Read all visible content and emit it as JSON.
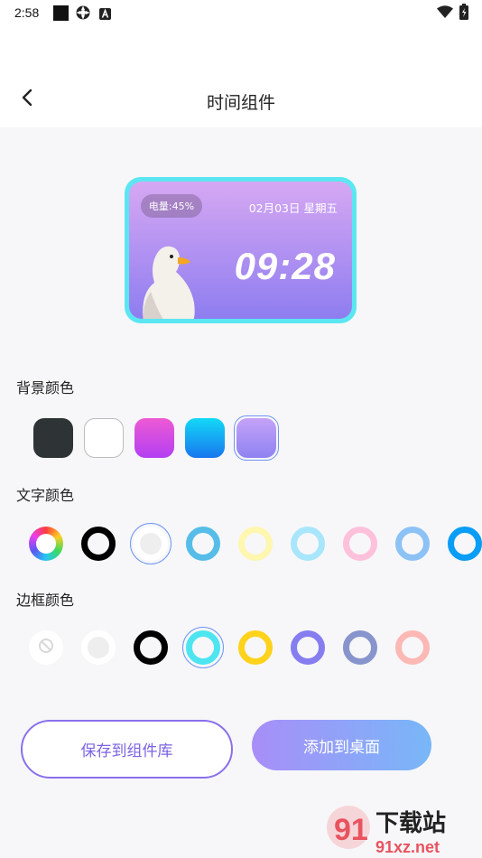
{
  "statusbar": {
    "time": "2:58",
    "left_icons": [
      "square-icon",
      "settings-gear-icon",
      "app-a-icon"
    ],
    "right_icons": [
      "wifi-icon",
      "battery-icon"
    ]
  },
  "header": {
    "title": "时间组件",
    "back_icon": "chevron-left-icon"
  },
  "widget_preview": {
    "battery_label": "电量:45%",
    "date_label": "02月03日 星期五",
    "time_label": "09:28",
    "border_color": "#5be6f2",
    "gradient": [
      "#d6a8f3",
      "#8e7df0"
    ]
  },
  "background_color": {
    "label": "背景颜色",
    "options": [
      {
        "name": "dark",
        "color": "#2e3336"
      },
      {
        "name": "white",
        "color": "#ffffff"
      },
      {
        "name": "pink-purple",
        "color": "#d64fe6"
      },
      {
        "name": "cyan-blue",
        "color": "#1a9cf2"
      },
      {
        "name": "lavender",
        "color": "#a292f5"
      }
    ],
    "selected": "lavender"
  },
  "text_color": {
    "label": "文字颜色",
    "options": [
      {
        "name": "rainbow",
        "color": "multi"
      },
      {
        "name": "black",
        "color": "#000000"
      },
      {
        "name": "white",
        "color": "#eeeeee"
      },
      {
        "name": "sky",
        "color": "#56bde8"
      },
      {
        "name": "cream",
        "color": "#fff6b0"
      },
      {
        "name": "light-cyan",
        "color": "#a8e6fb"
      },
      {
        "name": "pink",
        "color": "#fdc1dc"
      },
      {
        "name": "light-blue",
        "color": "#8cc2f5"
      },
      {
        "name": "blue",
        "color": "#0a9df5"
      }
    ],
    "selected": "white"
  },
  "border_color": {
    "label": "边框颜色",
    "options": [
      {
        "name": "none",
        "color": "none"
      },
      {
        "name": "white",
        "color": "#eeeeee"
      },
      {
        "name": "black",
        "color": "#000000"
      },
      {
        "name": "cyan",
        "color": "#4de5f0"
      },
      {
        "name": "yellow",
        "color": "#ffd21c"
      },
      {
        "name": "purple",
        "color": "#857df0"
      },
      {
        "name": "slate",
        "color": "#8894cc"
      },
      {
        "name": "salmon",
        "color": "#fcb8b4"
      }
    ],
    "selected": "cyan"
  },
  "actions": {
    "save_label": "保存到组件库",
    "add_label": "添加到桌面"
  },
  "watermark": {
    "brand": "下载站",
    "domain": "91xz.net",
    "logo": "91"
  }
}
